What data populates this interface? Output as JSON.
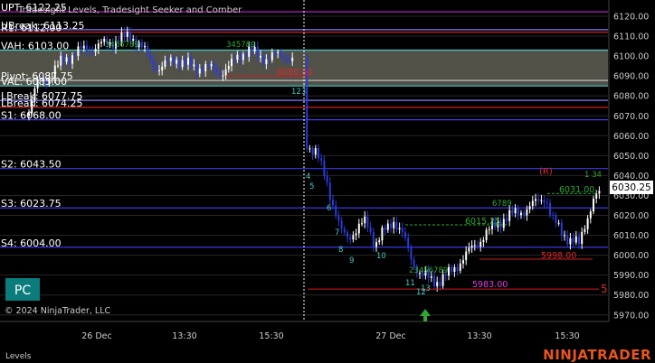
{
  "header": {
    "title": "Tradesight Levels, Tradesight Seeker and Comber"
  },
  "levels": [
    {
      "name": "UPT",
      "label": "UPT: 6122.25",
      "price": 6122.25,
      "color": "#c81ed2",
      "show_label": true
    },
    {
      "name": "UBreak",
      "label": "UBreak: 6113.25",
      "price": 6113.25,
      "color": "#7d7dff",
      "show_label": true
    },
    {
      "name": "R1",
      "label": "R1: 6112.00",
      "price": 6112.0,
      "color": "#d21e1e",
      "show_label": true
    },
    {
      "name": "VAH",
      "label": "VAH: 6103.00",
      "price": 6103.0,
      "color": "#46c8c8",
      "show_label": true
    },
    {
      "name": "Pivot",
      "label": "Pivot: 6087.75",
      "price": 6087.75,
      "color": "#bbbbbb",
      "show_label": true
    },
    {
      "name": "VAL",
      "label": "VAL: 6085.00",
      "price": 6085.0,
      "color": "#46c8c8",
      "show_label": true
    },
    {
      "name": "LBreak",
      "label": "LBreak: 6077.75",
      "price": 6077.75,
      "color": "#7d7dff",
      "show_label": true
    },
    {
      "name": "LBreak2",
      "label": "LBreak: 6074.25",
      "price": 6074.25,
      "color": "#d21e1e",
      "show_label": true
    },
    {
      "name": "S1",
      "label": "S1: 6068.00",
      "price": 6068.0,
      "color": "#3a3ae0",
      "show_label": true
    },
    {
      "name": "S2",
      "label": "S2: 6043.50",
      "price": 6043.5,
      "color": "#3a3ae0",
      "show_label": true
    },
    {
      "name": "S3",
      "label": "S3: 6023.75",
      "price": 6023.75,
      "color": "#3a3ae0",
      "show_label": true
    },
    {
      "name": "S4",
      "label": "S4: 6004.00",
      "price": 6004.0,
      "color": "#3a3ae0",
      "show_label": true
    }
  ],
  "price_axis": {
    "ticks": [
      "6120.00",
      "6110.00",
      "6100.00",
      "6090.00",
      "6080.00",
      "6070.00",
      "6060.00",
      "6050.00",
      "6040.00",
      "6030.00",
      "6020.00",
      "6010.00",
      "6000.00",
      "5990.00",
      "5980.00",
      "5970.00"
    ],
    "tick_values": [
      6120,
      6110,
      6100,
      6090,
      6080,
      6070,
      6060,
      6050,
      6040,
      6030,
      6020,
      6010,
      6000,
      5990,
      5980,
      5970
    ],
    "current_price": "6030.25",
    "current_value": 6030.25
  },
  "time_axis": {
    "labels": [
      "26 Dec",
      "13:30",
      "15:30",
      "27 Dec",
      "13:30",
      "15:30"
    ]
  },
  "annotations": {
    "red_levels": [
      {
        "text": "6090.00",
        "price": 6090.0
      },
      {
        "text": "5998.00",
        "price": 5998.0
      }
    ],
    "green_level": {
      "text": "6015.25",
      "price": 6015.25
    },
    "green_level2": {
      "text": "6031.00",
      "price": 6031.0
    },
    "magenta_level": {
      "text": "5983.00",
      "price": 5983.0
    },
    "red_r": "(R)",
    "five_mark": "5",
    "seq_green_top": "3456789",
    "seq_green_top2": "345789",
    "seq_green_right": "1 34",
    "seq_cyan": [
      "4",
      "5",
      "6",
      "7",
      "8",
      "9",
      "10",
      "11",
      "12",
      "13"
    ],
    "seq_cyan_top": "123",
    "seq_green_mid": "6789",
    "seq_green_bottom": "23456789"
  },
  "badge": {
    "text": "PC"
  },
  "copyright": "© 2024 NinjaTrader, LLC",
  "bottom_tab": "Levels",
  "brand": {
    "text": "NINJATRADER",
    "accent": "#e8551e"
  },
  "colors": {
    "bg": "#000000",
    "axis_text": "#cccccc",
    "grid": "#262626",
    "value_area": "#55554c",
    "badge_bg": "#0a7c7c"
  }
}
